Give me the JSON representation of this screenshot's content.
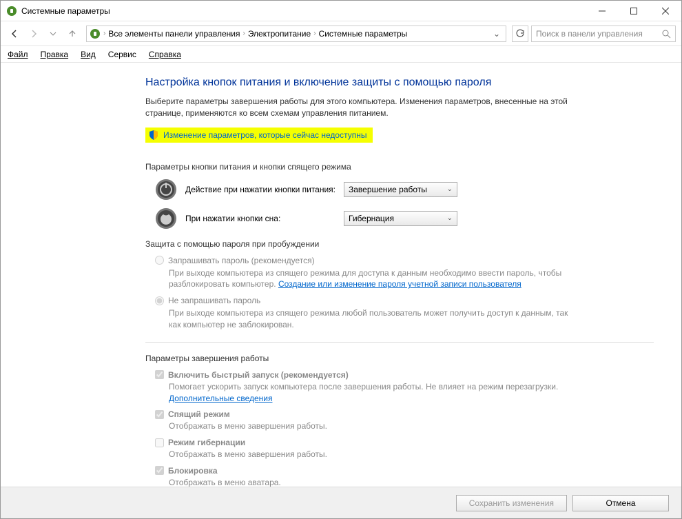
{
  "window": {
    "title": "Системные параметры"
  },
  "breadcrumb": {
    "items": [
      "Все элементы панели управления",
      "Электропитание",
      "Системные параметры"
    ]
  },
  "search": {
    "placeholder": "Поиск в панели управления"
  },
  "menu": {
    "file": "Файл",
    "edit": "Правка",
    "view": "Вид",
    "service": "Сервис",
    "help": "Справка"
  },
  "page": {
    "title": "Настройка кнопок питания и включение защиты с помощью пароля",
    "desc": "Выберите параметры завершения работы для этого компьютера. Изменения параметров, внесенные на этой странице, применяются ко всем схемам управления питанием.",
    "admin_link": "Изменение параметров, которые сейчас недоступны"
  },
  "section1": {
    "heading": "Параметры кнопки питания и кнопки спящего режима",
    "power_button_label": "Действие при нажатии кнопки питания:",
    "power_button_value": "Завершение работы",
    "sleep_button_label": "При нажатии кнопки сна:",
    "sleep_button_value": "Гибернация"
  },
  "section2": {
    "heading": "Защита с помощью пароля при пробуждении",
    "radio1_label": "Запрашивать пароль (рекомендуется)",
    "radio1_desc": "При выходе компьютера из спящего режима для доступа к данным необходимо ввести пароль, чтобы разблокировать компьютер. ",
    "radio1_link": "Создание или изменение пароля учетной записи пользователя",
    "radio2_label": "Не запрашивать пароль",
    "radio2_desc": "При выходе компьютера из спящего режима любой пользователь может получить доступ к данным, так как компьютер не заблокирован."
  },
  "section3": {
    "heading": "Параметры завершения работы",
    "fast_startup_label": "Включить быстрый запуск (рекомендуется)",
    "fast_startup_desc": "Помогает ускорить запуск компьютера после завершения работы. Не влияет на режим перезагрузки. ",
    "fast_startup_link": "Дополнительные сведения",
    "sleep_label": "Спящий режим",
    "sleep_desc": "Отображать в меню завершения работы.",
    "hibernate_label": "Режим гибернации",
    "hibernate_desc": "Отображать в меню завершения работы.",
    "lock_label": "Блокировка",
    "lock_desc": "Отображать в меню аватара."
  },
  "footer": {
    "save": "Сохранить изменения",
    "cancel": "Отмена"
  }
}
